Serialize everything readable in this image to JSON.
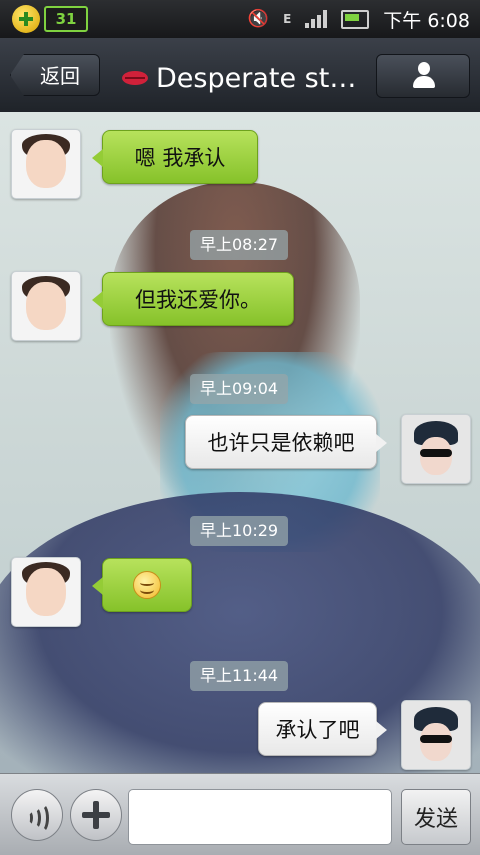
{
  "status_bar": {
    "app_badge": "31",
    "network_type": "E",
    "time": "下午 6:08"
  },
  "header": {
    "back_label": "返回",
    "title": "Desperate str...",
    "title_icon": "lips-icon",
    "profile_icon": "person-icon"
  },
  "messages": [
    {
      "sender": "other",
      "text": "嗯 我承认"
    },
    {
      "timestamp": "早上08:27"
    },
    {
      "sender": "other",
      "text": "但我还爱你。"
    },
    {
      "timestamp": "早上09:04"
    },
    {
      "sender": "me",
      "text": "也许只是依赖吧"
    },
    {
      "timestamp": "早上10:29"
    },
    {
      "sender": "other",
      "emoji": "smile-icon"
    },
    {
      "timestamp": "早上11:44"
    },
    {
      "sender": "me",
      "text": "承认了吧"
    }
  ],
  "input_bar": {
    "voice_icon": "voice-icon",
    "plus_icon": "plus-icon",
    "input_value": "",
    "send_label": "发送"
  },
  "colors": {
    "bubble_green": "#9ed241",
    "bubble_white": "#f4f4f4",
    "header_bg": "#2b2f36"
  }
}
